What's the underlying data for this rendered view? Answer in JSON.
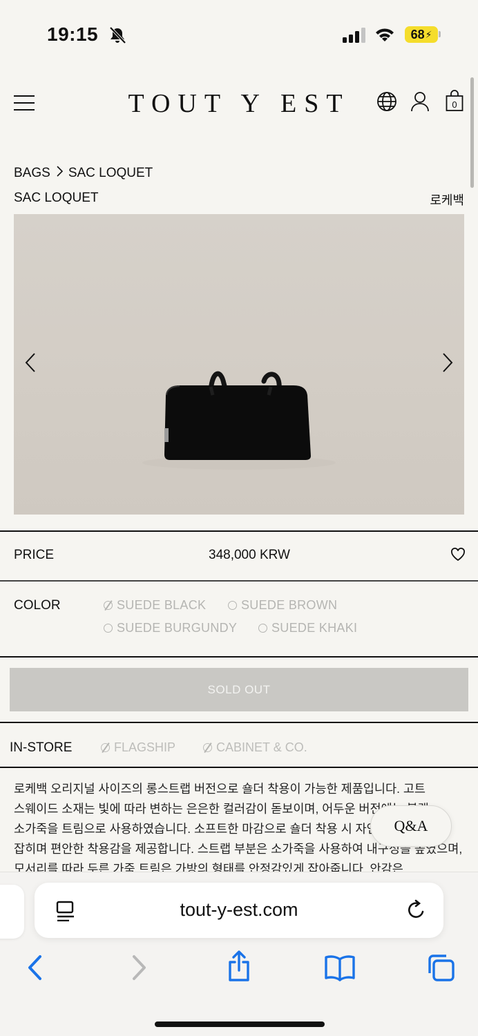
{
  "status_bar": {
    "time": "19:15",
    "battery": "68"
  },
  "header": {
    "logo": "TOUT Y EST",
    "cart_count": "0"
  },
  "breadcrumb": {
    "category": "BAGS",
    "product": "SAC LOQUET"
  },
  "product": {
    "title": "SAC LOQUET",
    "title_kr": "로케백",
    "price_label": "PRICE",
    "price": "348,000 KRW",
    "color_label": "COLOR",
    "colors": [
      "SUEDE BLACK",
      "SUEDE BROWN",
      "SUEDE BURGUNDY",
      "SUEDE KHAKI"
    ],
    "sold_out_label": "SOLD OUT",
    "instore_label": "IN-STORE",
    "stores": [
      "FLAGSHIP",
      "CABINET & CO."
    ],
    "description": "로케백 오리지널 사이즈의 롱스트랩 버전으로 숄더 착용이 가능한 제품입니다. 고트 스웨이드 소재는 빛에 따라 변하는 은은한 컬러감이 돋보이며, 어두운 버전에는 블랙 소가죽을 트림으로 사용하였습니다. 소프트한 마감으로 숄더 착용 시 자연스럽게 핏이 잡히며 편안한 착용감을 제공합니다. 스트랩 부분은 소가죽을 사용하여 내구성을 높였으며, 모서리를 따라 두른 가죽 트림은 가방의 형태를 안정감있게 잡아줍니다. 안감은"
  },
  "qa_label": "Q&A",
  "browser": {
    "url": "tout-y-est.com"
  },
  "colors_theme": {
    "background": "#f6f5f1",
    "sold_out_bg": "#c9c8c4",
    "battery": "#f5dd2c",
    "safari_blue": "#1a73e8"
  }
}
